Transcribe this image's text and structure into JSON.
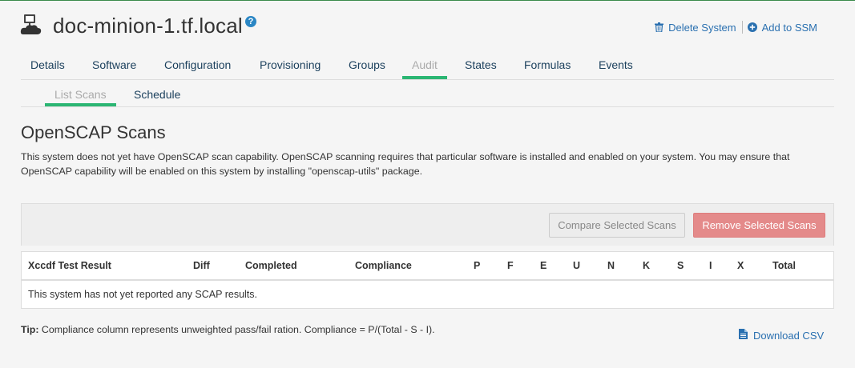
{
  "header": {
    "system_name": "doc-minion-1.tf.local",
    "help_glyph": "?",
    "delete_label": "Delete System",
    "add_ssm_label": "Add to SSM"
  },
  "tabs": [
    "Details",
    "Software",
    "Configuration",
    "Provisioning",
    "Groups",
    "Audit",
    "States",
    "Formulas",
    "Events"
  ],
  "active_tab": "Audit",
  "subtabs": [
    "List Scans",
    "Schedule"
  ],
  "active_subtab": "List Scans",
  "section": {
    "title": "OpenSCAP Scans",
    "description": "This system does not yet have OpenSCAP scan capability. OpenSCAP scanning requires that particular software is installed and enabled on your system. You may ensure that OpenSCAP capability will be enabled on this system by installing \"openscap-utils\" package."
  },
  "toolbar": {
    "compare_label": "Compare Selected Scans",
    "remove_label": "Remove Selected Scans"
  },
  "table": {
    "columns": [
      "Xccdf Test Result",
      "Diff",
      "Completed",
      "Compliance",
      "P",
      "F",
      "E",
      "U",
      "N",
      "K",
      "S",
      "I",
      "X",
      "Total"
    ],
    "empty_message": "This system has not yet reported any SCAP results."
  },
  "footer": {
    "tip_label": "Tip:",
    "tip_text": " Compliance column represents unweighted pass/fail ration. Compliance = P/(Total - S - I).",
    "download_label": "Download CSV"
  },
  "colors": {
    "accent_green": "#2bb673",
    "link_blue": "#2a70b0",
    "danger": "#e48a8a"
  },
  "icons": {
    "system": "server-cloud-icon",
    "help": "help-circle-icon",
    "delete": "trash-icon",
    "add": "plus-circle-icon",
    "download": "file-icon"
  }
}
